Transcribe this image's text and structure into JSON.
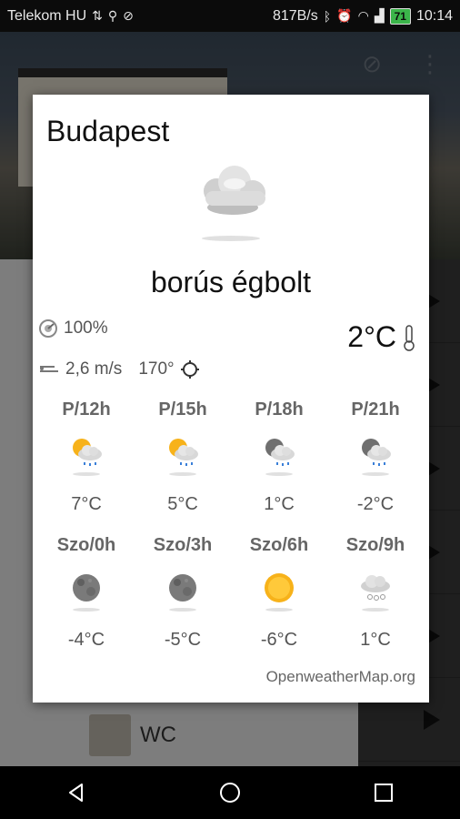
{
  "status_bar": {
    "carrier": "Telekom HU",
    "net_speed": "817B/s",
    "battery": "71",
    "time": "10:14"
  },
  "background": {
    "list_item_label": "WC"
  },
  "dialog": {
    "city": "Budapest",
    "description": "borús égbolt",
    "humidity": "100%",
    "wind_speed": "2,6 m/s",
    "wind_direction": "170°",
    "temperature": "2°C",
    "main_icon": "overcast-cloud-icon",
    "forecast": [
      {
        "time": "P/12h",
        "temp": "7°C",
        "icon": "sun-cloud-rain-icon"
      },
      {
        "time": "P/15h",
        "temp": "5°C",
        "icon": "sun-cloud-rain-icon"
      },
      {
        "time": "P/18h",
        "temp": "1°C",
        "icon": "moon-cloud-rain-icon"
      },
      {
        "time": "P/21h",
        "temp": "-2°C",
        "icon": "moon-cloud-rain-icon"
      },
      {
        "time": "Szo/0h",
        "temp": "-4°C",
        "icon": "moon-icon"
      },
      {
        "time": "Szo/3h",
        "temp": "-5°C",
        "icon": "moon-icon"
      },
      {
        "time": "Szo/6h",
        "temp": "-6°C",
        "icon": "sun-icon"
      },
      {
        "time": "Szo/9h",
        "temp": "1°C",
        "icon": "cloud-snow-icon"
      }
    ],
    "provider": "OpenweatherMap.org"
  },
  "colors": {
    "dialog_bg": "#ffffff",
    "status_bar": "#0b0b0b",
    "battery": "#3bb54a",
    "sun": "#f7b21a"
  }
}
